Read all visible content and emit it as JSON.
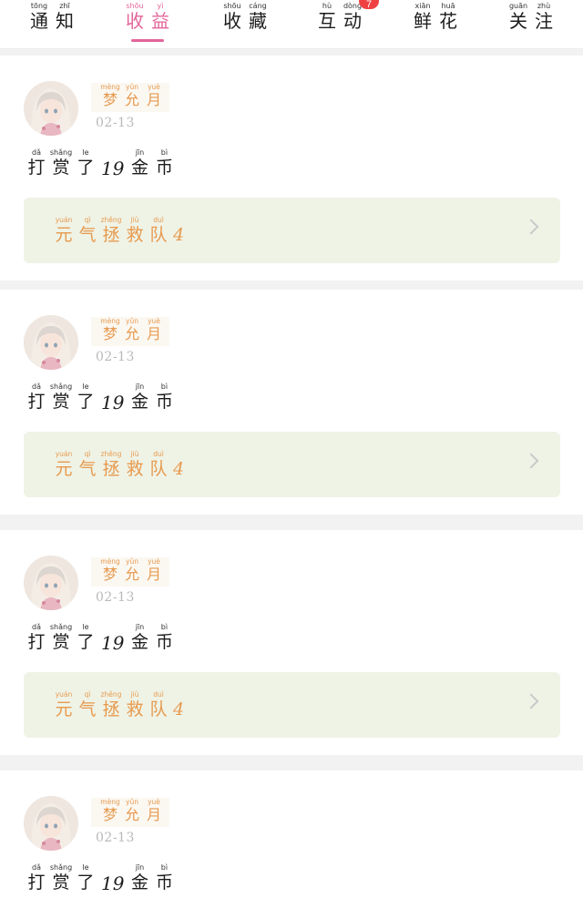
{
  "tabs": [
    {
      "id": "tongzhi",
      "chars": [
        {
          "py": "tōng",
          "hz": "通"
        },
        {
          "py": "zhī",
          "hz": "知"
        }
      ]
    },
    {
      "id": "shouyi",
      "chars": [
        {
          "py": "shōu",
          "hz": "收"
        },
        {
          "py": "yì",
          "hz": "益"
        }
      ],
      "active": true
    },
    {
      "id": "shoucang",
      "chars": [
        {
          "py": "shōu",
          "hz": "收"
        },
        {
          "py": "cáng",
          "hz": "藏"
        }
      ]
    },
    {
      "id": "hudong",
      "chars": [
        {
          "py": "hù",
          "hz": "互"
        },
        {
          "py": "dòng",
          "hz": "动"
        }
      ],
      "badge": "7"
    },
    {
      "id": "xianhua",
      "chars": [
        {
          "py": "xiān",
          "hz": "鲜"
        },
        {
          "py": "huā",
          "hz": "花"
        }
      ]
    },
    {
      "id": "guanzhu",
      "chars": [
        {
          "py": "guān",
          "hz": "关"
        },
        {
          "py": "zhù",
          "hz": "注"
        }
      ]
    }
  ],
  "accent_color": "#e3659b",
  "name_color": "#e79a4f",
  "badge_color": "#f04142",
  "feed": [
    {
      "avatar_icon": "anime-girl-avatar",
      "username": [
        {
          "py": "mèng",
          "hz": "梦"
        },
        {
          "py": "yǔn",
          "hz": "允"
        },
        {
          "py": "yuè",
          "hz": "月"
        }
      ],
      "date": "02-13",
      "action": {
        "pre": [
          {
            "py": "dǎ",
            "hz": "打"
          },
          {
            "py": "shǎng",
            "hz": "赏"
          },
          {
            "py": "le",
            "hz": "了"
          }
        ],
        "number": "19",
        "post": [
          {
            "py": "jīn",
            "hz": "金"
          },
          {
            "py": "bì",
            "hz": "币"
          }
        ]
      },
      "link": {
        "chars": [
          {
            "py": "yuán",
            "hz": "元"
          },
          {
            "py": "qì",
            "hz": "气"
          },
          {
            "py": "zhěng",
            "hz": "拯"
          },
          {
            "py": "jiù",
            "hz": "救"
          },
          {
            "py": "duì",
            "hz": "队"
          }
        ],
        "number": "4"
      }
    },
    {
      "avatar_icon": "anime-girl-avatar",
      "username": [
        {
          "py": "mèng",
          "hz": "梦"
        },
        {
          "py": "yǔn",
          "hz": "允"
        },
        {
          "py": "yuè",
          "hz": "月"
        }
      ],
      "date": "02-13",
      "action": {
        "pre": [
          {
            "py": "dǎ",
            "hz": "打"
          },
          {
            "py": "shǎng",
            "hz": "赏"
          },
          {
            "py": "le",
            "hz": "了"
          }
        ],
        "number": "19",
        "post": [
          {
            "py": "jīn",
            "hz": "金"
          },
          {
            "py": "bì",
            "hz": "币"
          }
        ]
      },
      "link": {
        "chars": [
          {
            "py": "yuán",
            "hz": "元"
          },
          {
            "py": "qì",
            "hz": "气"
          },
          {
            "py": "zhěng",
            "hz": "拯"
          },
          {
            "py": "jiù",
            "hz": "救"
          },
          {
            "py": "duì",
            "hz": "队"
          }
        ],
        "number": "4"
      }
    },
    {
      "avatar_icon": "anime-girl-avatar",
      "username": [
        {
          "py": "mèng",
          "hz": "梦"
        },
        {
          "py": "yǔn",
          "hz": "允"
        },
        {
          "py": "yuè",
          "hz": "月"
        }
      ],
      "date": "02-13",
      "action": {
        "pre": [
          {
            "py": "dǎ",
            "hz": "打"
          },
          {
            "py": "shǎng",
            "hz": "赏"
          },
          {
            "py": "le",
            "hz": "了"
          }
        ],
        "number": "19",
        "post": [
          {
            "py": "jīn",
            "hz": "金"
          },
          {
            "py": "bì",
            "hz": "币"
          }
        ]
      },
      "link": {
        "chars": [
          {
            "py": "yuán",
            "hz": "元"
          },
          {
            "py": "qì",
            "hz": "气"
          },
          {
            "py": "zhěng",
            "hz": "拯"
          },
          {
            "py": "jiù",
            "hz": "救"
          },
          {
            "py": "duì",
            "hz": "队"
          }
        ],
        "number": "4"
      }
    },
    {
      "avatar_icon": "anime-girl-avatar",
      "username": [
        {
          "py": "mèng",
          "hz": "梦"
        },
        {
          "py": "yǔn",
          "hz": "允"
        },
        {
          "py": "yuè",
          "hz": "月"
        }
      ],
      "date": "02-13",
      "action": {
        "pre": [
          {
            "py": "dǎ",
            "hz": "打"
          },
          {
            "py": "shǎng",
            "hz": "赏"
          },
          {
            "py": "le",
            "hz": "了"
          }
        ],
        "number": "19",
        "post": [
          {
            "py": "jīn",
            "hz": "金"
          },
          {
            "py": "bì",
            "hz": "币"
          }
        ]
      }
    }
  ]
}
